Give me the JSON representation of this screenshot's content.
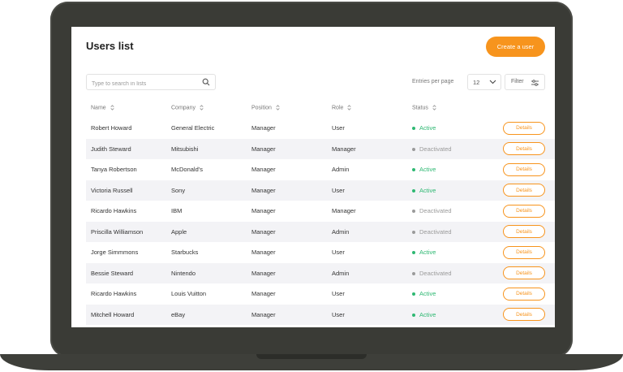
{
  "page": {
    "title": "Users list",
    "create_label": "Create a user",
    "search_placeholder": "Type to search in lists",
    "entries_label": "Entries per page",
    "entries_value": "12",
    "filter_label": "Filter"
  },
  "table": {
    "headers": [
      "Name",
      "Company",
      "Position",
      "Role",
      "Status"
    ],
    "rows": [
      {
        "name": "Robert Howard",
        "company": "General Electric",
        "position": "Manager",
        "role": "User",
        "status": "Active",
        "details": "Details"
      },
      {
        "name": "Judith Steward",
        "company": "Mitsubishi",
        "position": "Manager",
        "role": "Manager",
        "status": "Deactivated",
        "details": "Details"
      },
      {
        "name": "Tanya Robertson",
        "company": "McDonald's",
        "position": "Manager",
        "role": "Admin",
        "status": "Active",
        "details": "Details"
      },
      {
        "name": "Victoria Russell",
        "company": "Sony",
        "position": "Manager",
        "role": "User",
        "status": "Active",
        "details": "Details"
      },
      {
        "name": "Ricardo Hawkins",
        "company": "IBM",
        "position": "Manager",
        "role": "Manager",
        "status": "Deactivated",
        "details": "Details"
      },
      {
        "name": "Priscilla Williamson",
        "company": "Apple",
        "position": "Manager",
        "role": "Admin",
        "status": "Deactivated",
        "details": "Details"
      },
      {
        "name": "Jorge Simmmons",
        "company": "Starbucks",
        "position": "Manager",
        "role": "User",
        "status": "Active",
        "details": "Details"
      },
      {
        "name": "Bessie Steward",
        "company": "Nintendo",
        "position": "Manager",
        "role": "Admin",
        "status": "Deactivated",
        "details": "Details"
      },
      {
        "name": "Ricardo Hawkins",
        "company": "Louis Vuitton",
        "position": "Manager",
        "role": "User",
        "status": "Active",
        "details": "Details"
      },
      {
        "name": "Mitchell Howard",
        "company": "eBay",
        "position": "Manager",
        "role": "User",
        "status": "Active",
        "details": "Details"
      }
    ]
  },
  "colors": {
    "accent": "#f7941d",
    "active": "#2eb872",
    "deactivated": "#9a9a9a",
    "device": "#3a3b36"
  }
}
